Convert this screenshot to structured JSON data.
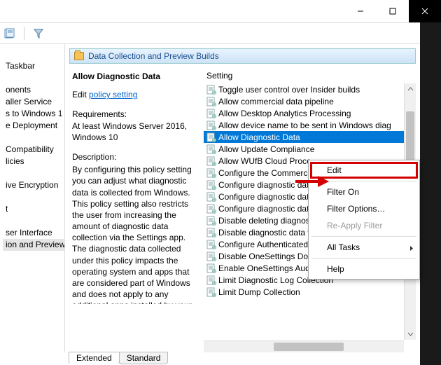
{
  "titlebar": {
    "minimize": "–",
    "maximize": "□",
    "close": "×"
  },
  "toolbar": {
    "icon1": "props-icon",
    "icon2": "filter-icon"
  },
  "tree": {
    "items": [
      "",
      "Taskbar",
      "",
      "onents",
      "aller Service",
      "s to Windows 1",
      "e Deployment",
      "",
      "Compatibility",
      "licies",
      "",
      "ive Encryption",
      "",
      "t",
      "",
      "ser Interface",
      "ion and Preview",
      ""
    ],
    "selected_index": 16
  },
  "category": {
    "title": "Data Collection and Preview Builds"
  },
  "description": {
    "title": "Allow Diagnostic Data",
    "edit_prefix": "Edit",
    "edit_link": "policy setting",
    "requirements_label": "Requirements:",
    "requirements_text": "At least Windows Server 2016, Windows 10",
    "description_label": "Description:",
    "description_text": "By configuring this policy setting you can adjust what diagnostic data is collected from Windows. This policy setting also restricts the user from increasing the amount of diagnostic data collection via the Settings app. The diagnostic data collected under this policy impacts the operating system and apps that are considered part of Windows and does not apply to any additional apps installed by your organization."
  },
  "setting": {
    "header": "Setting",
    "items": [
      "Toggle user control over Insider builds",
      "Allow commercial data pipeline",
      "Allow Desktop Analytics Processing",
      "Allow device name to be sent in Windows diag",
      "Allow Diagnostic Data",
      "Allow Update Compliance",
      "Allow WUfB Cloud Proce",
      "Configure the Commercial",
      "Configure diagnostic dat",
      "Configure diagnostic dat",
      "Configure diagnostic dat",
      "Disable deleting diagnost",
      "Disable diagnostic data viewer",
      "Configure Authenticated Proxy usage for the C",
      "Disable OneSettings Downloads",
      "Enable OneSettings Auditing",
      "Limit Diagnostic Log Collection",
      "Limit Dump Collection"
    ],
    "selected_index": 4
  },
  "tabs": {
    "extended": "Extended",
    "standard": "Standard"
  },
  "context_menu": {
    "edit": "Edit",
    "filter_on": "Filter On",
    "filter_options": "Filter Options…",
    "reapply": "Re-Apply Filter",
    "all_tasks": "All Tasks",
    "help": "Help"
  }
}
